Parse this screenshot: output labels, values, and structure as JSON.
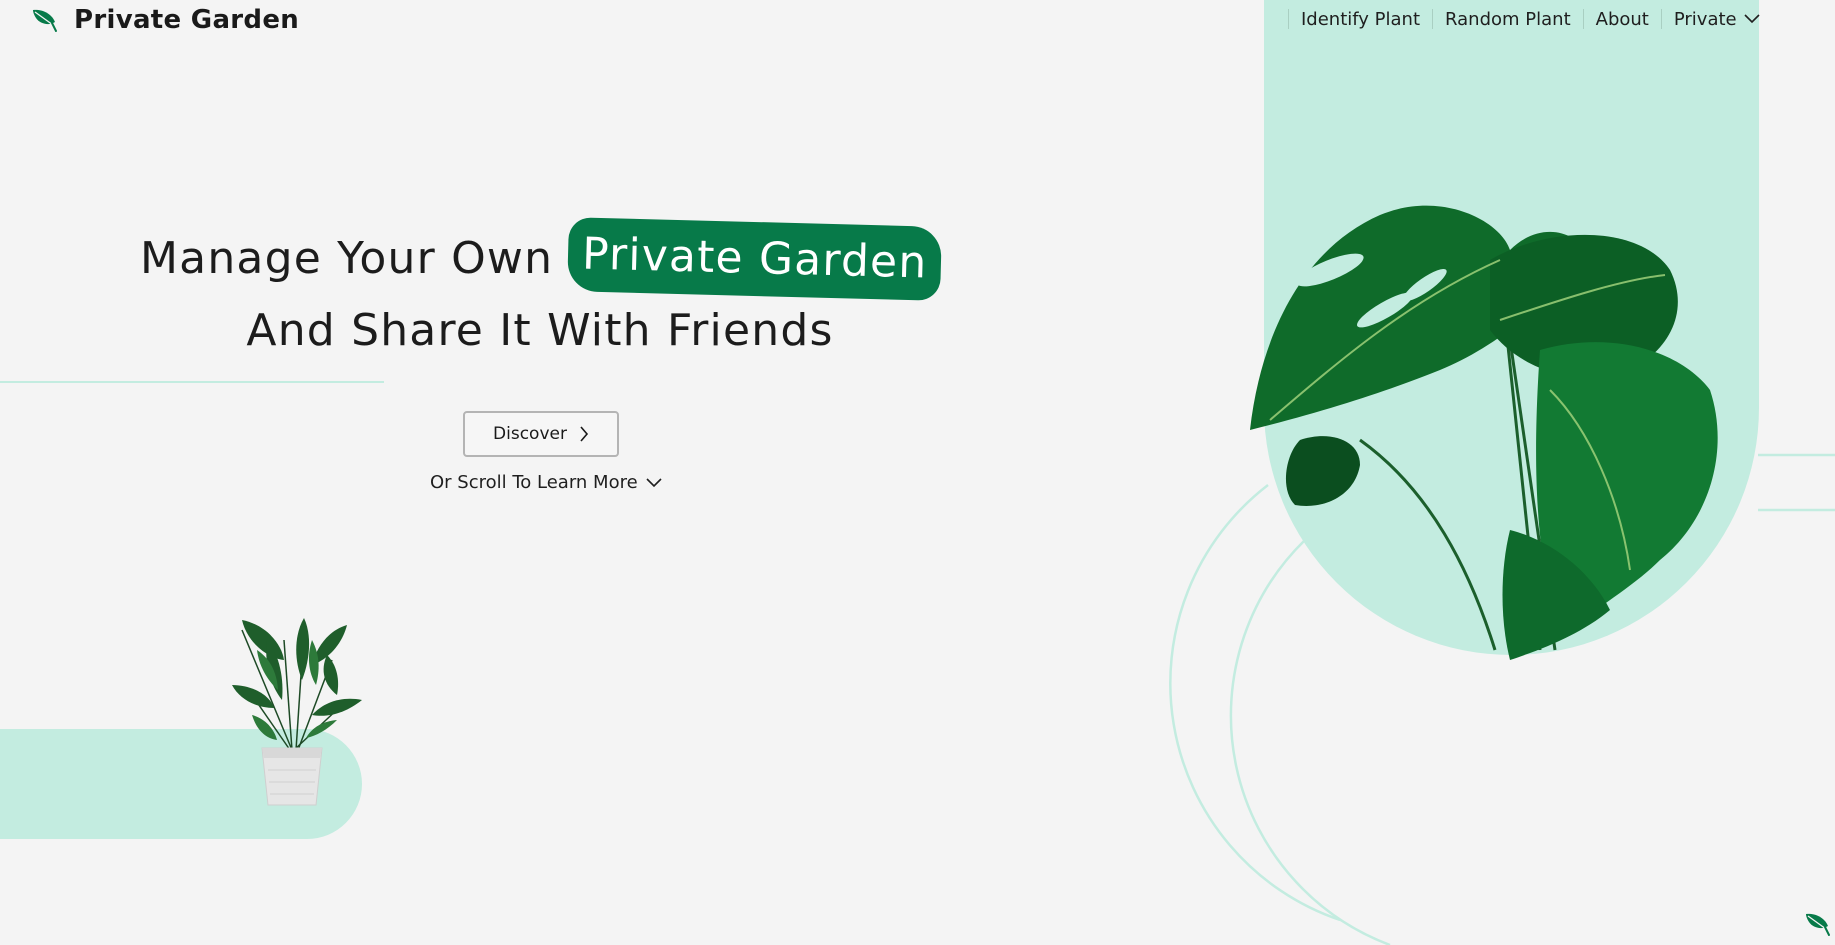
{
  "header": {
    "brand_name": "Private Garden",
    "brand_icon": "leaf-icon"
  },
  "nav": {
    "items": [
      {
        "label": "Identify Plant"
      },
      {
        "label": "Random Plant"
      },
      {
        "label": "About"
      },
      {
        "label": "Private",
        "icon": "chevron-down-icon"
      }
    ]
  },
  "hero": {
    "title_part1": "Manage Your Own",
    "title_highlight": "Private Garden",
    "title_line2": "And Share It With Friends",
    "discover_label": "Discover",
    "discover_icon": "chevron-right-icon",
    "scroll_hint": "Or Scroll To Learn More",
    "scroll_icon": "chevron-down-icon"
  },
  "images": {
    "small_plant": "potted-plant-image",
    "hero_plant": "monstera-plant-image"
  },
  "colors": {
    "background": "#f4f4f4",
    "mint": "#c3ece0",
    "brand_green": "#077a49",
    "text": "#1a1a1a"
  }
}
